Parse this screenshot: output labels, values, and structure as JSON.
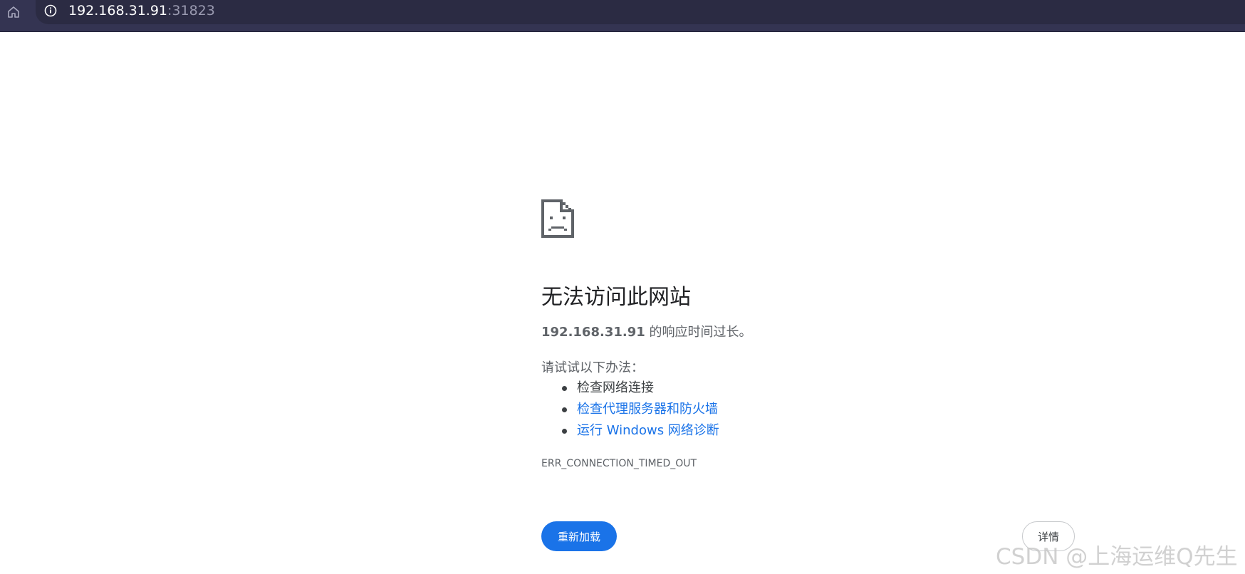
{
  "address_bar": {
    "host": "192.168.31.91",
    "port": ":31823"
  },
  "icons": {
    "home": "home-icon",
    "site_info": "info-icon",
    "error": "sad-document-icon"
  },
  "error_page": {
    "title": "无法访问此网站",
    "summary_ip": "192.168.31.91",
    "summary_text": " 的响应时间过长。",
    "suggestions_heading": "请试试以下办法：",
    "suggestions": [
      {
        "label": "检查网络连接",
        "is_link": false
      },
      {
        "label": "检查代理服务器和防火墙",
        "is_link": true
      },
      {
        "label": "运行 Windows 网络诊断",
        "is_link": true
      }
    ],
    "error_code": "ERR_CONNECTION_TIMED_OUT",
    "reload_label": "重新加载",
    "details_label": "详情"
  },
  "watermark": "CSDN @上海运维Q先生",
  "colors": {
    "topbar": "#343452",
    "accent": "#1a73e8",
    "text": "#5f6368"
  }
}
